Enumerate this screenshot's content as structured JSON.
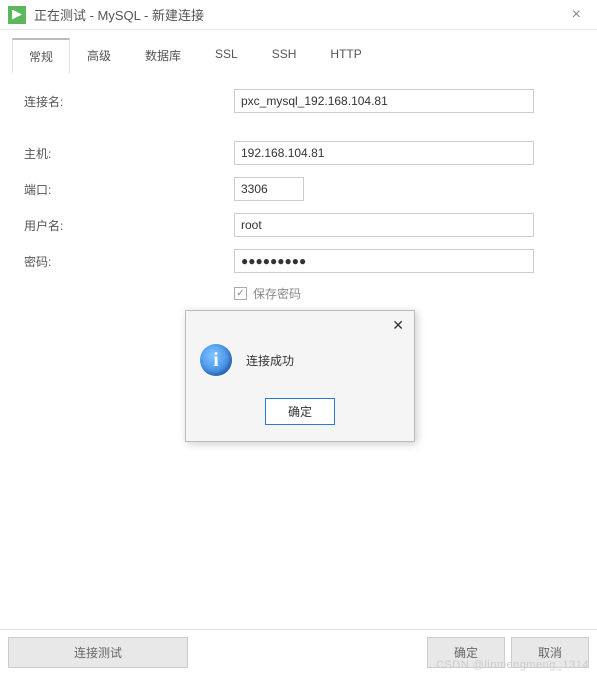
{
  "window": {
    "title": "正在测试 - MySQL - 新建连接"
  },
  "tabs": {
    "general": "常规",
    "advanced": "高级",
    "database": "数据库",
    "ssl": "SSL",
    "ssh": "SSH",
    "http": "HTTP"
  },
  "form": {
    "connection_name_label": "连接名:",
    "connection_name_value": "pxc_mysql_192.168.104.81",
    "host_label": "主机:",
    "host_value": "192.168.104.81",
    "port_label": "端口:",
    "port_value": "3306",
    "username_label": "用户名:",
    "username_value": "root",
    "password_label": "密码:",
    "password_value": "●●●●●●●●●",
    "save_password_label": "保存密码"
  },
  "dialog": {
    "message": "连接成功",
    "ok": "确定"
  },
  "footer": {
    "test": "连接测试",
    "ok": "确定",
    "cancel": "取消"
  },
  "watermark": "CSDN @linmengmeng_1314"
}
